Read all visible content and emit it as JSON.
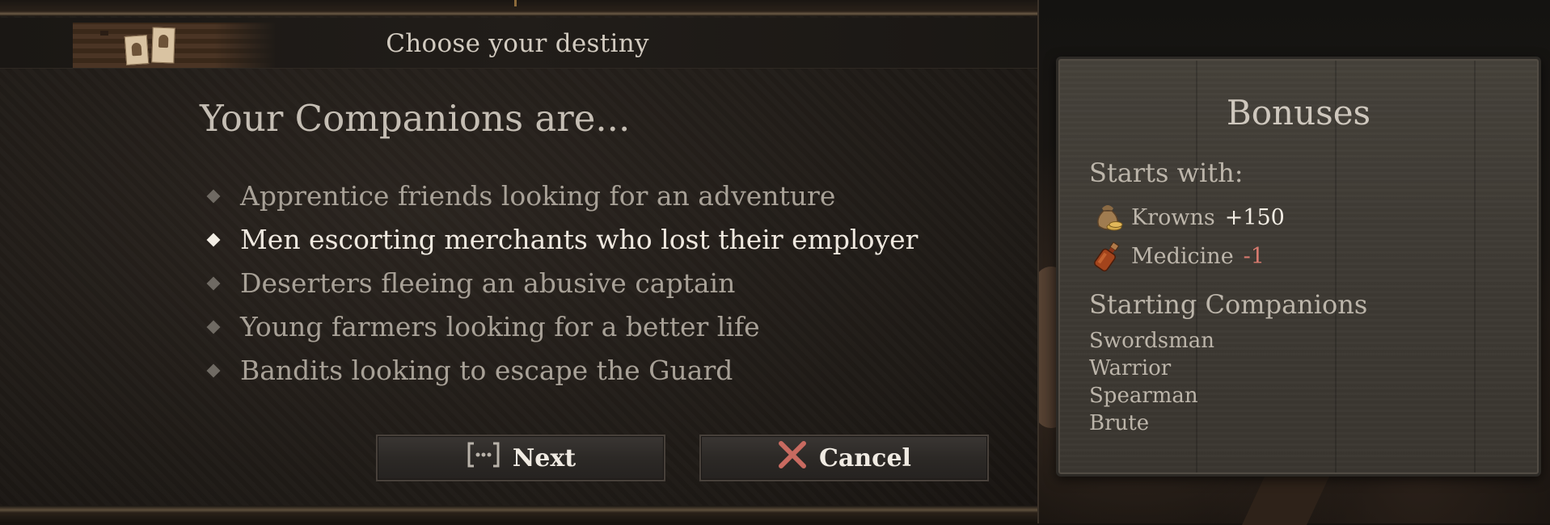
{
  "dialog": {
    "title": "Choose your destiny",
    "question": "Your Companions are...",
    "options": [
      {
        "label": "Apprentice friends looking for an adventure",
        "selected": false
      },
      {
        "label": "Men escorting merchants who lost their employer",
        "selected": true
      },
      {
        "label": "Deserters fleeing an abusive captain",
        "selected": false
      },
      {
        "label": "Young farmers looking for a better life",
        "selected": false
      },
      {
        "label": "Bandits looking to escape the Guard",
        "selected": false
      }
    ],
    "buttons": {
      "next": {
        "label": "Next",
        "icon": "controller-view-icon"
      },
      "cancel": {
        "label": "Cancel",
        "icon": "close-x-icon",
        "icon_color": "#c86a60"
      }
    }
  },
  "bonuses": {
    "title": "Bonuses",
    "starts_with_label": "Starts with:",
    "resources": [
      {
        "name": "Krowns",
        "amount": "+150",
        "icon": "coin-pouch-icon"
      },
      {
        "name": "Medicine",
        "amount": "-1",
        "icon": "medicine-bottle-icon"
      }
    ],
    "companions_label": "Starting Companions",
    "companions": [
      "Swordsman",
      "Warrior",
      "Spearman",
      "Brute"
    ]
  },
  "colors": {
    "selected_text": "#efe9e0",
    "unselected_text": "#a8a197",
    "positive": "#f2ede4",
    "negative": "#d87a6e"
  }
}
